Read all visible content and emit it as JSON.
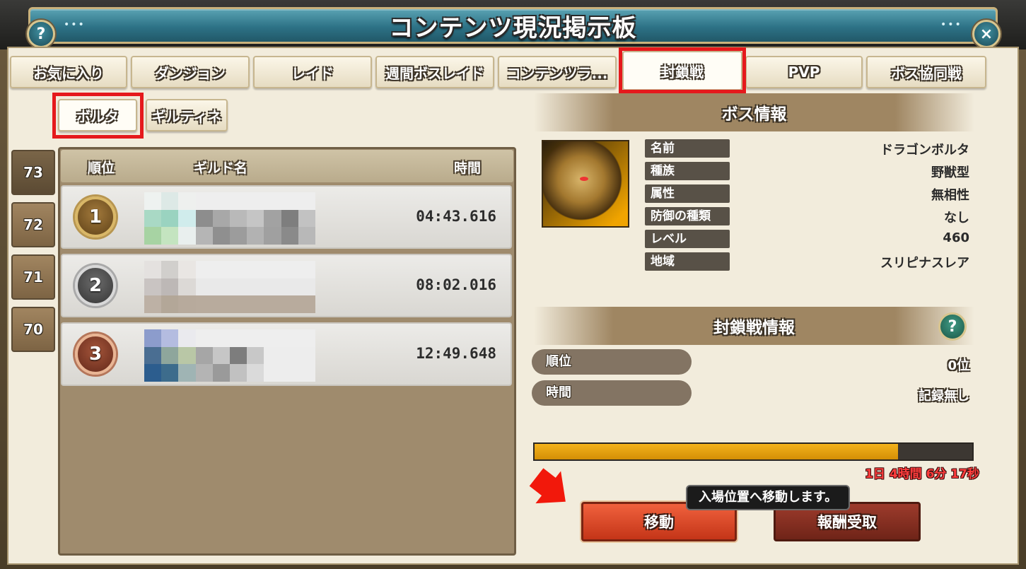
{
  "window": {
    "title": "コンテンツ現況掲示板",
    "help_icon": "?",
    "close_icon": "×"
  },
  "tabs": [
    {
      "label": "お気に入り"
    },
    {
      "label": "ダンジョン"
    },
    {
      "label": "レイド"
    },
    {
      "label": "週間ボスレイド"
    },
    {
      "label": "コンテンツラ..."
    },
    {
      "label": "封鎖戦",
      "active": true
    },
    {
      "label": "PVP"
    },
    {
      "label": "ボス協同戦"
    }
  ],
  "subtabs": [
    {
      "label": "ボルタ",
      "active": true
    },
    {
      "label": "ギルティネ"
    }
  ],
  "levels": [
    "73",
    "72",
    "71",
    "70"
  ],
  "ranking": {
    "headers": {
      "rank": "順位",
      "guild": "ギルド名",
      "time": "時間"
    },
    "rows": [
      {
        "rank": "1",
        "medal": "gold",
        "time": "04:43.616"
      },
      {
        "rank": "2",
        "medal": "silver",
        "time": "08:02.016"
      },
      {
        "rank": "3",
        "medal": "bronze",
        "time": "12:49.648"
      }
    ]
  },
  "boss_info": {
    "title": "ボス情報",
    "fields": [
      {
        "label": "名前",
        "value": "ドラゴンボルタ"
      },
      {
        "label": "種族",
        "value": "野獣型"
      },
      {
        "label": "属性",
        "value": "無相性"
      },
      {
        "label": "防御の種類",
        "value": "なし"
      },
      {
        "label": "レベル",
        "value": "460"
      },
      {
        "label": "地域",
        "value": "スリピナスレア"
      }
    ]
  },
  "blockade_info": {
    "title": "封鎖戦情報",
    "help_icon": "?",
    "rank_label": "順位",
    "rank_value": "0位",
    "time_label": "時間",
    "time_value": "記録無し"
  },
  "progress": {
    "fraction": 0.83,
    "remaining": "1日 4時間 6分 17秒"
  },
  "buttons": {
    "move": "移動",
    "reward": "報酬受取"
  },
  "tooltip": "入場位置へ移動します。",
  "colors": {
    "highlight": "#e5191c",
    "progress": "#f4b21b",
    "move_button": "#f0613d"
  }
}
